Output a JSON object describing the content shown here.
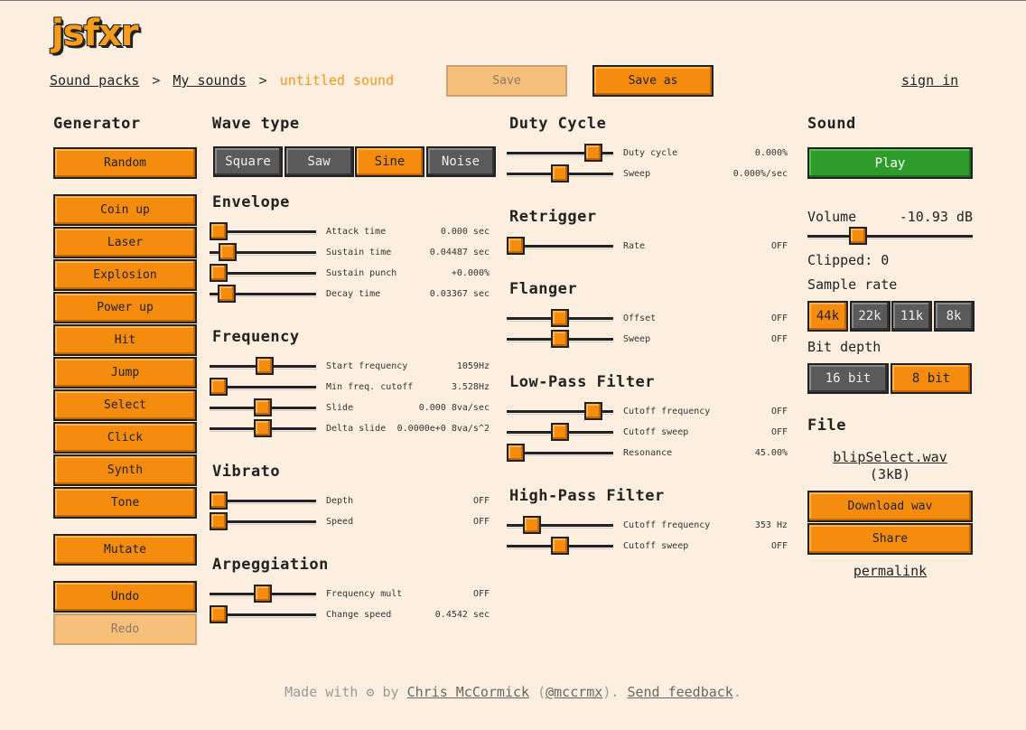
{
  "app": {
    "logo": "jsfxr"
  },
  "breadcrumb": {
    "sound_packs": "Sound packs",
    "sep1": ">",
    "my_sounds": "My sounds",
    "sep2": ">",
    "current": "untitled sound"
  },
  "toolbar": {
    "save_label": "Save",
    "save_as_label": "Save as",
    "sign_in": "sign in"
  },
  "generator": {
    "heading": "Generator",
    "random": "Random",
    "presets": [
      "Coin up",
      "Laser",
      "Explosion",
      "Power up",
      "Hit",
      "Jump",
      "Select",
      "Click",
      "Synth",
      "Tone"
    ],
    "mutate": "Mutate",
    "undo": "Undo",
    "redo": "Redo"
  },
  "wave_type": {
    "heading": "Wave type",
    "options": [
      "Square",
      "Saw",
      "Sine",
      "Noise"
    ],
    "selected": "Sine"
  },
  "envelope": {
    "heading": "Envelope",
    "sliders": [
      {
        "label": "Attack time",
        "value": "0.000 sec",
        "level": 0.0
      },
      {
        "label": "Sustain time",
        "value": "0.04487 sec",
        "level": 0.1
      },
      {
        "label": "Sustain punch",
        "value": "+0.000%",
        "level": 0.0
      },
      {
        "label": "Decay time",
        "value": "0.03367 sec",
        "level": 0.09
      }
    ]
  },
  "frequency": {
    "heading": "Frequency",
    "sliders": [
      {
        "label": "Start frequency",
        "value": "1059Hz",
        "level": 0.52
      },
      {
        "label": "Min freq. cutoff",
        "value": "3.528Hz",
        "level": 0.0
      },
      {
        "label": "Slide",
        "value": "0.000 8va/sec",
        "level": 0.5
      },
      {
        "label": "Delta slide",
        "value": "0.0000e+0 8va/s^2",
        "level": 0.5
      }
    ]
  },
  "vibrato": {
    "heading": "Vibrato",
    "sliders": [
      {
        "label": "Depth",
        "value": "OFF",
        "level": 0.0
      },
      {
        "label": "Speed",
        "value": "OFF",
        "level": 0.0
      }
    ]
  },
  "arpeggiation": {
    "heading": "Arpeggiation",
    "sliders": [
      {
        "label": "Frequency mult",
        "value": "OFF",
        "level": 0.5
      },
      {
        "label": "Change speed",
        "value": "0.4542 sec",
        "level": 0.0
      }
    ]
  },
  "duty_cycle": {
    "heading": "Duty Cycle",
    "sliders": [
      {
        "label": "Duty cycle",
        "value": "0.000%",
        "level": 0.88
      },
      {
        "label": "Sweep",
        "value": "0.000%/sec",
        "level": 0.5
      }
    ]
  },
  "retrigger": {
    "heading": "Retrigger",
    "sliders": [
      {
        "label": "Rate",
        "value": "OFF",
        "level": 0.0
      }
    ]
  },
  "flanger": {
    "heading": "Flanger",
    "sliders": [
      {
        "label": "Offset",
        "value": "OFF",
        "level": 0.5
      },
      {
        "label": "Sweep",
        "value": "OFF",
        "level": 0.5
      }
    ]
  },
  "low_pass": {
    "heading": "Low-Pass Filter",
    "sliders": [
      {
        "label": "Cutoff frequency",
        "value": "OFF",
        "level": 0.88
      },
      {
        "label": "Cutoff sweep",
        "value": "OFF",
        "level": 0.5
      },
      {
        "label": "Resonance",
        "value": "45.00%",
        "level": 0.0
      }
    ]
  },
  "high_pass": {
    "heading": "High-Pass Filter",
    "sliders": [
      {
        "label": "Cutoff frequency",
        "value": "353 Hz",
        "level": 0.18
      },
      {
        "label": "Cutoff sweep",
        "value": "OFF",
        "level": 0.5
      }
    ]
  },
  "sound": {
    "heading": "Sound",
    "play": "Play",
    "volume_label": "Volume",
    "volume_value": "-10.93 dB",
    "volume_level": 0.28,
    "clipped": "Clipped: 0",
    "sample_rate_label": "Sample rate",
    "sample_rates": [
      "44k",
      "22k",
      "11k",
      "8k"
    ],
    "sample_rate_selected": "44k",
    "bit_depth_label": "Bit depth",
    "bit_depths": [
      "16 bit",
      "8 bit"
    ],
    "bit_depth_selected": "8 bit"
  },
  "file": {
    "heading": "File",
    "filename": "blipSelect.wav",
    "size": "(3kB)",
    "download": "Download wav",
    "share": "Share",
    "permalink": "permalink"
  },
  "footer": {
    "made_with": "Made with",
    "by": "by",
    "author": "Chris McCormick",
    "handle_open": "(",
    "handle": "@mccrmx",
    "handle_close": ").",
    "feedback": "Send feedback",
    "end": "."
  },
  "colors": {
    "accent": "#f68c0e",
    "background": "#fcefe0",
    "play": "#2e9c2a",
    "segment_off": "#5a5a5a"
  }
}
